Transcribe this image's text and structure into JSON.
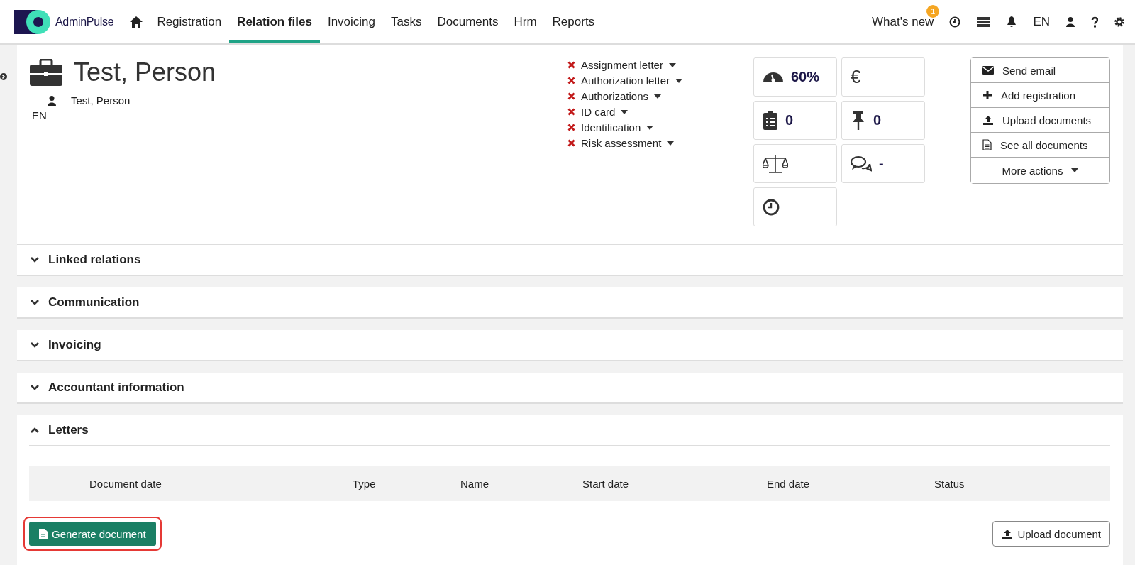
{
  "brand": {
    "name": "AdminPulse"
  },
  "nav": [
    {
      "label": "Registration",
      "selected": false
    },
    {
      "label": "Relation files",
      "selected": true
    },
    {
      "label": "Invoicing",
      "selected": false
    },
    {
      "label": "Tasks",
      "selected": false
    },
    {
      "label": "Documents",
      "selected": false
    },
    {
      "label": "Hrm",
      "selected": false
    },
    {
      "label": "Reports",
      "selected": false
    }
  ],
  "header_right": {
    "whats_new": "What's new",
    "badge": "1",
    "language": "EN"
  },
  "relation": {
    "name": "Test, Person",
    "contact": "Test, Person",
    "language": "EN"
  },
  "checklist": [
    {
      "label": "Assignment letter",
      "done": false
    },
    {
      "label": "Authorization letter",
      "done": false
    },
    {
      "label": "Authorizations",
      "done": false
    },
    {
      "label": "ID card",
      "done": false
    },
    {
      "label": "Identification",
      "done": false
    },
    {
      "label": "Risk assessment",
      "done": false
    }
  ],
  "tiles": [
    {
      "kind": "gauge",
      "value": "60%"
    },
    {
      "kind": "symbol",
      "value": "€"
    },
    {
      "kind": "clipboard",
      "value": "0"
    },
    {
      "kind": "pin",
      "value": "0"
    },
    {
      "kind": "scale"
    },
    {
      "kind": "chat",
      "value": "-"
    },
    {
      "kind": "clock"
    }
  ],
  "actions": [
    {
      "kind": "email",
      "label": "Send email"
    },
    {
      "kind": "plus",
      "label": "Add registration"
    },
    {
      "kind": "upload",
      "label": "Upload documents"
    },
    {
      "kind": "file",
      "label": "See all documents"
    },
    {
      "kind": "dropdown",
      "label": "More actions"
    }
  ],
  "sections": [
    {
      "title": "Linked relations",
      "expanded": false
    },
    {
      "title": "Communication",
      "expanded": false
    },
    {
      "title": "Invoicing",
      "expanded": false
    },
    {
      "title": "Accountant information",
      "expanded": false
    },
    {
      "title": "Letters",
      "expanded": true
    }
  ],
  "letters": {
    "columns": [
      "Document date",
      "Type",
      "Name",
      "Start date",
      "End date",
      "Status"
    ],
    "generate_button": {
      "label": "Generate document",
      "highlighted": true
    },
    "upload_button": {
      "label": "Upload document"
    }
  }
}
